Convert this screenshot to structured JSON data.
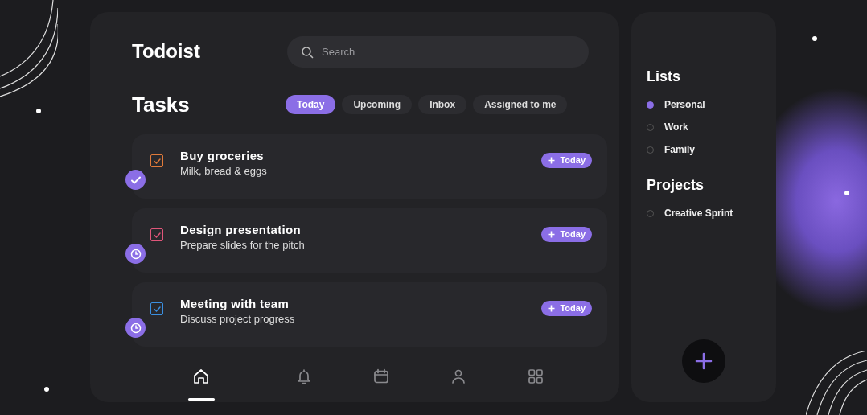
{
  "app": {
    "title": "Todoist"
  },
  "search": {
    "placeholder": "Search"
  },
  "heading": "Tasks",
  "filters": [
    {
      "label": "Today",
      "selected": true
    },
    {
      "label": "Upcoming",
      "selected": false
    },
    {
      "label": "Inbox",
      "selected": false
    },
    {
      "label": "Assigned to me",
      "selected": false
    }
  ],
  "tasks": [
    {
      "title": "Buy groceries",
      "note": "Milk, bread & eggs",
      "color": "#e07a3a",
      "checked": true,
      "kind": "done",
      "due": "Today"
    },
    {
      "title": "Design presentation",
      "note": "Prepare slides for the pitch",
      "color": "#e0567a",
      "checked": true,
      "kind": "clock",
      "due": "Today"
    },
    {
      "title": "Meeting with team",
      "note": "Discuss project progress",
      "color": "#3b8fe0",
      "checked": true,
      "kind": "clock",
      "due": "Today"
    }
  ],
  "nav": [
    {
      "kind": "home",
      "selected": true
    },
    {
      "kind": "bell",
      "selected": false
    },
    {
      "kind": "calendar",
      "selected": false
    },
    {
      "kind": "person",
      "selected": false
    },
    {
      "kind": "grid",
      "selected": false
    }
  ],
  "sidebar": {
    "lists_title": "Lists",
    "lists": [
      {
        "label": "Personal",
        "selected": true
      },
      {
        "label": "Work",
        "selected": false
      },
      {
        "label": "Family",
        "selected": false
      }
    ],
    "projects_title": "Projects",
    "projects": [
      {
        "label": "Creative Sprint",
        "selected": false
      }
    ]
  }
}
